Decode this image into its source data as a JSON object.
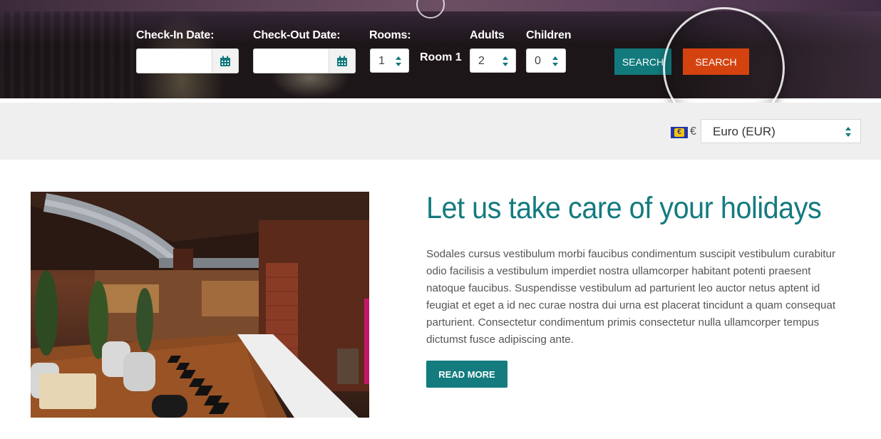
{
  "search": {
    "checkin_label": "Check-In Date:",
    "checkin_value": "",
    "checkout_label": "Check-Out Date:",
    "checkout_value": "",
    "rooms_label": "Rooms:",
    "rooms_value": "1",
    "room_name": "Room 1",
    "adults_label": "Adults",
    "adults_value": "2",
    "children_label": "Children",
    "children_value": "0",
    "search_button_1": "Search",
    "search_button_2": "Search",
    "calendar_icon": "calendar-icon",
    "colors": {
      "teal": "#127a7d",
      "orange": "#d4430f"
    }
  },
  "currency": {
    "flag_icon": "eu-flag-icon",
    "symbol": "€",
    "selected": "Euro (EUR)"
  },
  "content": {
    "headline": "Let us take care of your holidays",
    "body": "Sodales cursus vestibulum morbi faucibus condimentum suscipit vestibulum curabitur odio facilisis a vestibulum imperdiet nostra ullamcorper habitant potenti praesent natoque faucibus. Suspendisse vestibulum ad parturient leo auctor netus aptent id feugiat et eget a id nec curae nostra dui urna est placerat tincidunt a quam consequat parturient. Consectetur condimentum primis consectetur nulla ullamcorper tempus dictumst fusce adipiscing ante.",
    "read_more": "Read More",
    "accent_color": "#147b7f"
  }
}
